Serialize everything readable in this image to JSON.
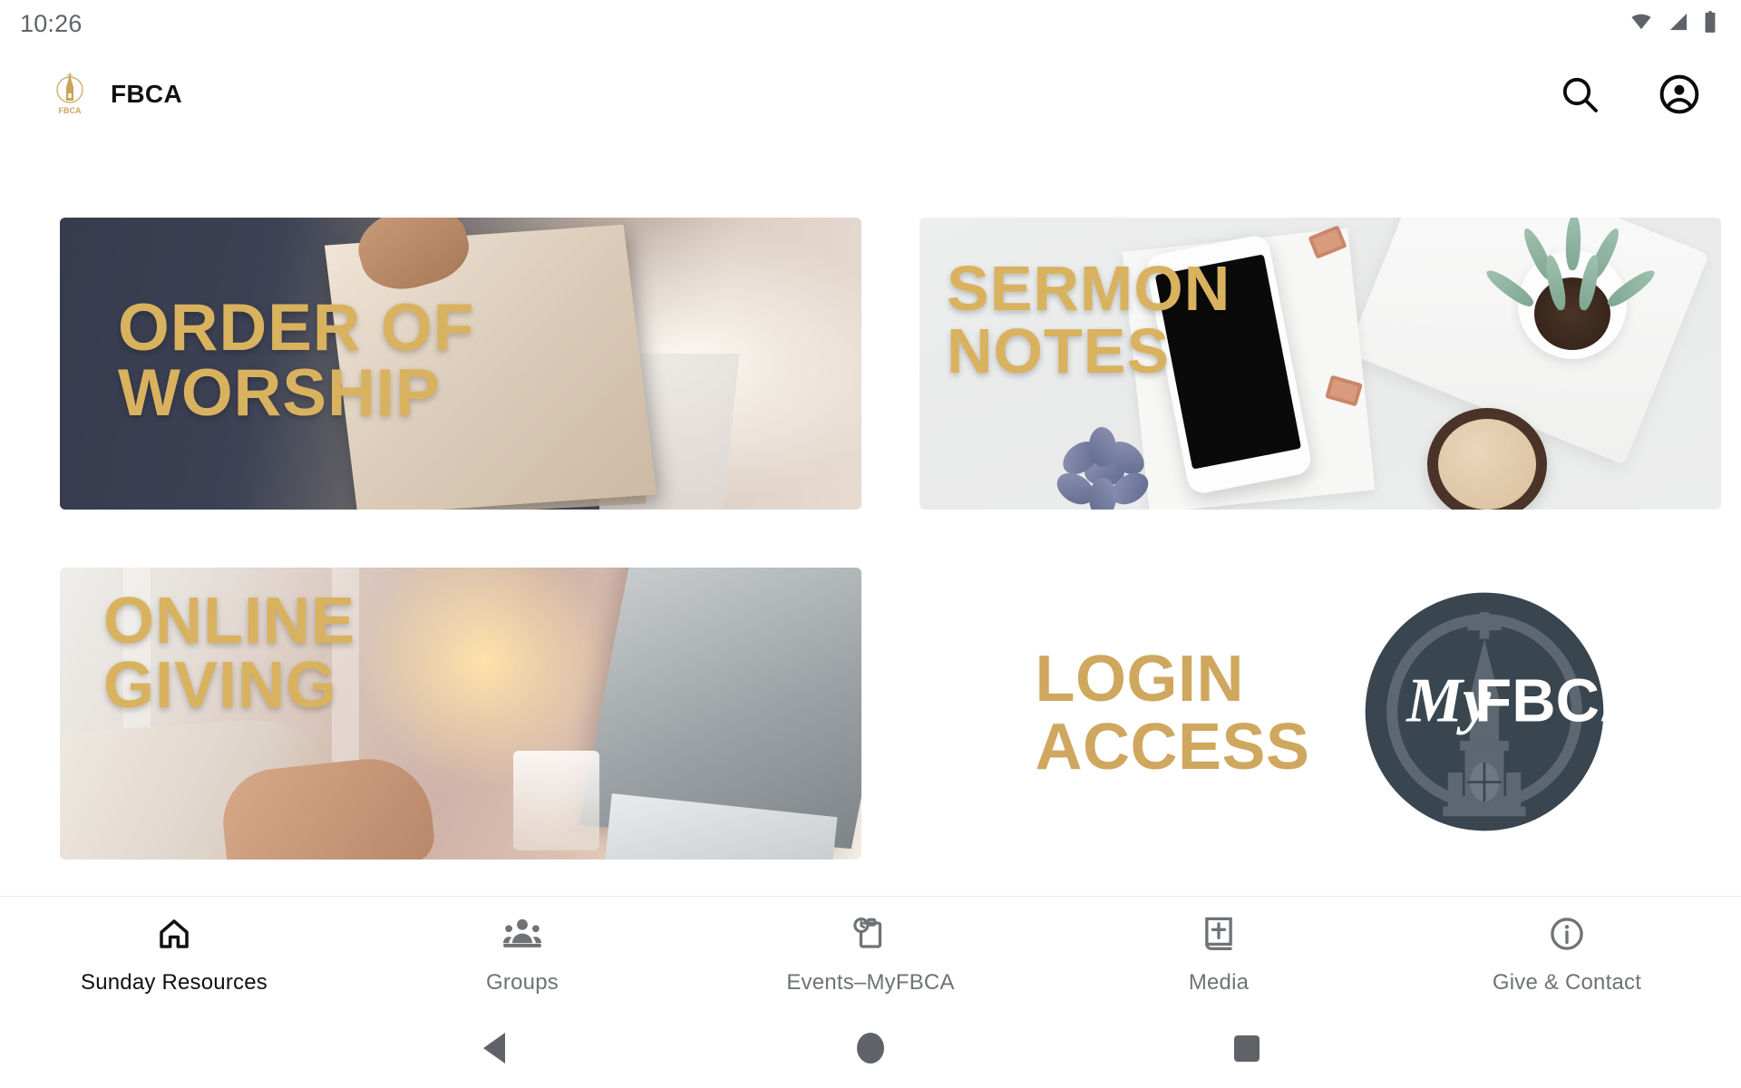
{
  "status_bar": {
    "time": "10:26",
    "icons": [
      "wifi-icon",
      "cellular-signal-icon",
      "battery-icon"
    ]
  },
  "app_bar": {
    "logo_name": "fbca-steeple-logo",
    "title": "FBCA",
    "actions": [
      {
        "name": "search-icon",
        "label": "Search"
      },
      {
        "name": "account-circle-icon",
        "label": "Account"
      }
    ]
  },
  "tiles": [
    {
      "id": "order-of-worship",
      "label_line1": "ORDER OF",
      "label_line2": "WORSHIP",
      "image_alt": "person-handing-bulletin-photo"
    },
    {
      "id": "sermon-notes",
      "label_line1": "SERMON",
      "label_line2": "NOTES",
      "image_alt": "desk-flatlay-phone-succulents-coffee-photo"
    },
    {
      "id": "online-giving",
      "label_line1": "ONLINE",
      "label_line2": "GIVING",
      "image_alt": "hands-typing-laptop-sunset-photo"
    },
    {
      "id": "login-access",
      "label_line1": "LOGIN",
      "label_line2": "ACCESS",
      "badge_script": "My",
      "badge_bold": "FBCA",
      "image_alt": "myfbca-steeple-circle-badge"
    }
  ],
  "bottom_nav": [
    {
      "id": "sunday-resources",
      "label": "Sunday Resources",
      "icon": "home-icon",
      "active": true
    },
    {
      "id": "groups",
      "label": "Groups",
      "icon": "people-group-icon",
      "active": false
    },
    {
      "id": "events-myfbca",
      "label": "Events–MyFBCA",
      "icon": "pending-actions-clock-icon",
      "active": false
    },
    {
      "id": "media",
      "label": "Media",
      "icon": "bible-book-icon",
      "active": false
    },
    {
      "id": "give-contact",
      "label": "Give & Contact",
      "icon": "info-circle-icon",
      "active": false
    }
  ],
  "system_nav": [
    {
      "id": "back",
      "icon": "back-triangle-icon"
    },
    {
      "id": "home",
      "icon": "home-circle-icon"
    },
    {
      "id": "recents",
      "icon": "recents-square-icon"
    }
  ],
  "colors": {
    "gold": "#d4a95f",
    "navy": "#39454f",
    "active_text": "#111111",
    "inactive_text": "#6f7376"
  }
}
